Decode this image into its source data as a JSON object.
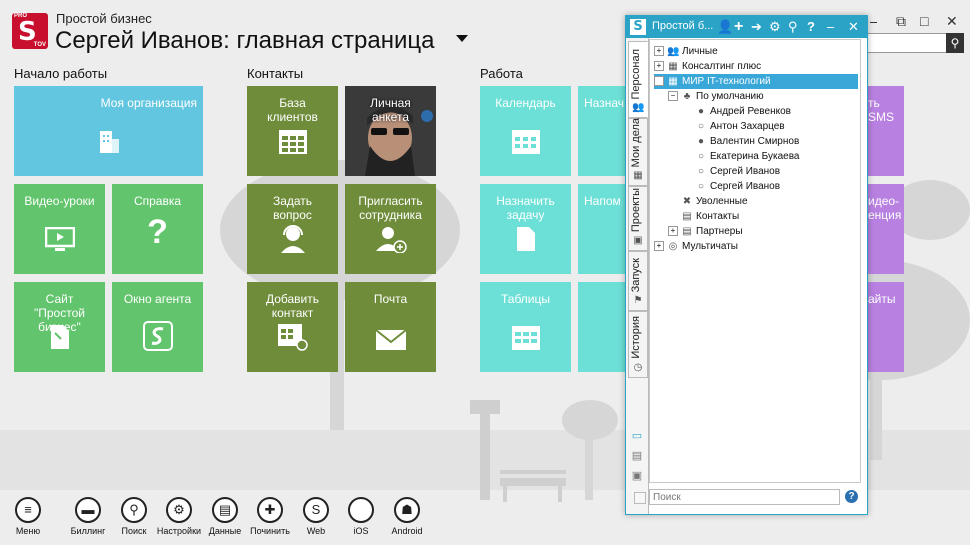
{
  "header": {
    "logo_pro": "PRO",
    "logo_letter": "S",
    "logo_tov": "TOV",
    "app_name": "Простой бизнес",
    "title": "Сергей Иванов: главная страница"
  },
  "groups": {
    "start": "Начало работы",
    "contacts": "Контакты",
    "work": "Работа"
  },
  "tiles": {
    "my_org": "Моя организация",
    "video": "Видео-уроки",
    "help": "Справка",
    "site": "Сайт \"Простой бизнес\"",
    "agent": "Окно агента",
    "clients": "База клиентов",
    "profile": "Личная анкета",
    "ask": "Задать вопрос",
    "invite": "Пригласить сотрудника",
    "add_contact": "Добавить контакт",
    "mail": "Почта",
    "calendar": "Календарь",
    "assign_partial": "Назнач",
    "assign_task": "Назначить задачу",
    "remind_partial": "Напом",
    "tables": "Таблицы",
    "sms": "ть SMS",
    "video2": "идео-\nенция",
    "sites": "айты"
  },
  "dock": [
    {
      "label": "Меню",
      "icon": "≡"
    },
    {
      "label": "Биллинг",
      "icon": "▬"
    },
    {
      "label": "Поиск",
      "icon": "⚲"
    },
    {
      "label": "Настройки",
      "icon": "⚙"
    },
    {
      "label": "Данные",
      "icon": "▤"
    },
    {
      "label": "Починить",
      "icon": "✚"
    },
    {
      "label": "Web",
      "icon": "S"
    },
    {
      "label": "iOS",
      "icon": ""
    },
    {
      "label": "Android",
      "icon": "☗"
    }
  ],
  "panel": {
    "title": "Простой б...",
    "tabs": [
      "Персонал",
      "Мои дела",
      "Проекты",
      "Запуск",
      "История"
    ],
    "search_placeholder": "Поиск",
    "help": "?",
    "tree": [
      {
        "label": "Личные",
        "level": 0,
        "exp": "+",
        "icon": "👥"
      },
      {
        "label": "Консалтинг плюс",
        "level": 0,
        "exp": "+",
        "icon": "▦"
      },
      {
        "label": "МИР IT-технологий",
        "level": 0,
        "exp": "−",
        "icon": "▦",
        "selected": true
      },
      {
        "label": "По умолчанию",
        "level": 1,
        "exp": "−",
        "icon": "♣"
      },
      {
        "label": "Андрей Ревенков",
        "level": 2,
        "exp": "",
        "icon": "●"
      },
      {
        "label": "Антон Захарцев",
        "level": 2,
        "exp": "",
        "icon": "○"
      },
      {
        "label": "Валентин Смирнов",
        "level": 2,
        "exp": "",
        "icon": "●"
      },
      {
        "label": "Екатерина Букаева",
        "level": 2,
        "exp": "",
        "icon": "○"
      },
      {
        "label": "Сергей Иванов",
        "level": 2,
        "exp": "",
        "icon": "○"
      },
      {
        "label": "Сергей Иванов",
        "level": 2,
        "exp": "",
        "icon": "○"
      },
      {
        "label": "Уволенные",
        "level": 1,
        "exp": "",
        "icon": "✖"
      },
      {
        "label": "Контакты",
        "level": 1,
        "exp": "",
        "icon": "▤"
      },
      {
        "label": "Партнеры",
        "level": 1,
        "exp": "+",
        "icon": "▤"
      },
      {
        "label": "Мультичаты",
        "level": 0,
        "exp": "+",
        "icon": "◎"
      }
    ]
  },
  "colors": {
    "blue": "#62c6e0",
    "green": "#62c46c",
    "olive": "#6f8c3a",
    "teal": "#6ce0d6",
    "purple": "#b880e0",
    "accent": "#2aa3c7",
    "selected": "#3aa7d9"
  }
}
